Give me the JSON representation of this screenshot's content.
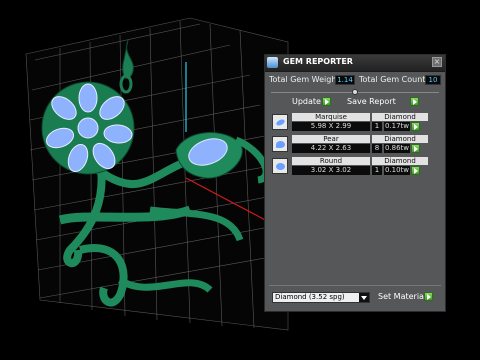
{
  "panel": {
    "title": "GEM REPORTER",
    "close_glyph": "×",
    "total_weight_label": "Total Gem Weight",
    "total_weight_value": "1.14",
    "total_count_label": "Total Gem Count",
    "total_count_value": "10",
    "update_label": "Update",
    "save_report_label": "Save Report",
    "gems": [
      {
        "shape": "Marquise",
        "size": "5.98 X 2.99",
        "material": "Diamond",
        "count": "1",
        "weight": "0.17tw"
      },
      {
        "shape": "Pear",
        "size": "4.22 X 2.63",
        "material": "Diamond",
        "count": "8",
        "weight": "0.86tw"
      },
      {
        "shape": "Round",
        "size": "3.02 X 3.02",
        "material": "Diamond",
        "count": "1",
        "weight": "0.10tw"
      }
    ],
    "material_select": "Diamond    (3.52 spg)",
    "set_material_label": "Set Material"
  },
  "colors": {
    "metal": "#1f8a5c",
    "gem": "#8fb2ff",
    "grid": "#777777",
    "axis_red": "#d41a1a",
    "axis_cyan": "#2ec8e8"
  }
}
